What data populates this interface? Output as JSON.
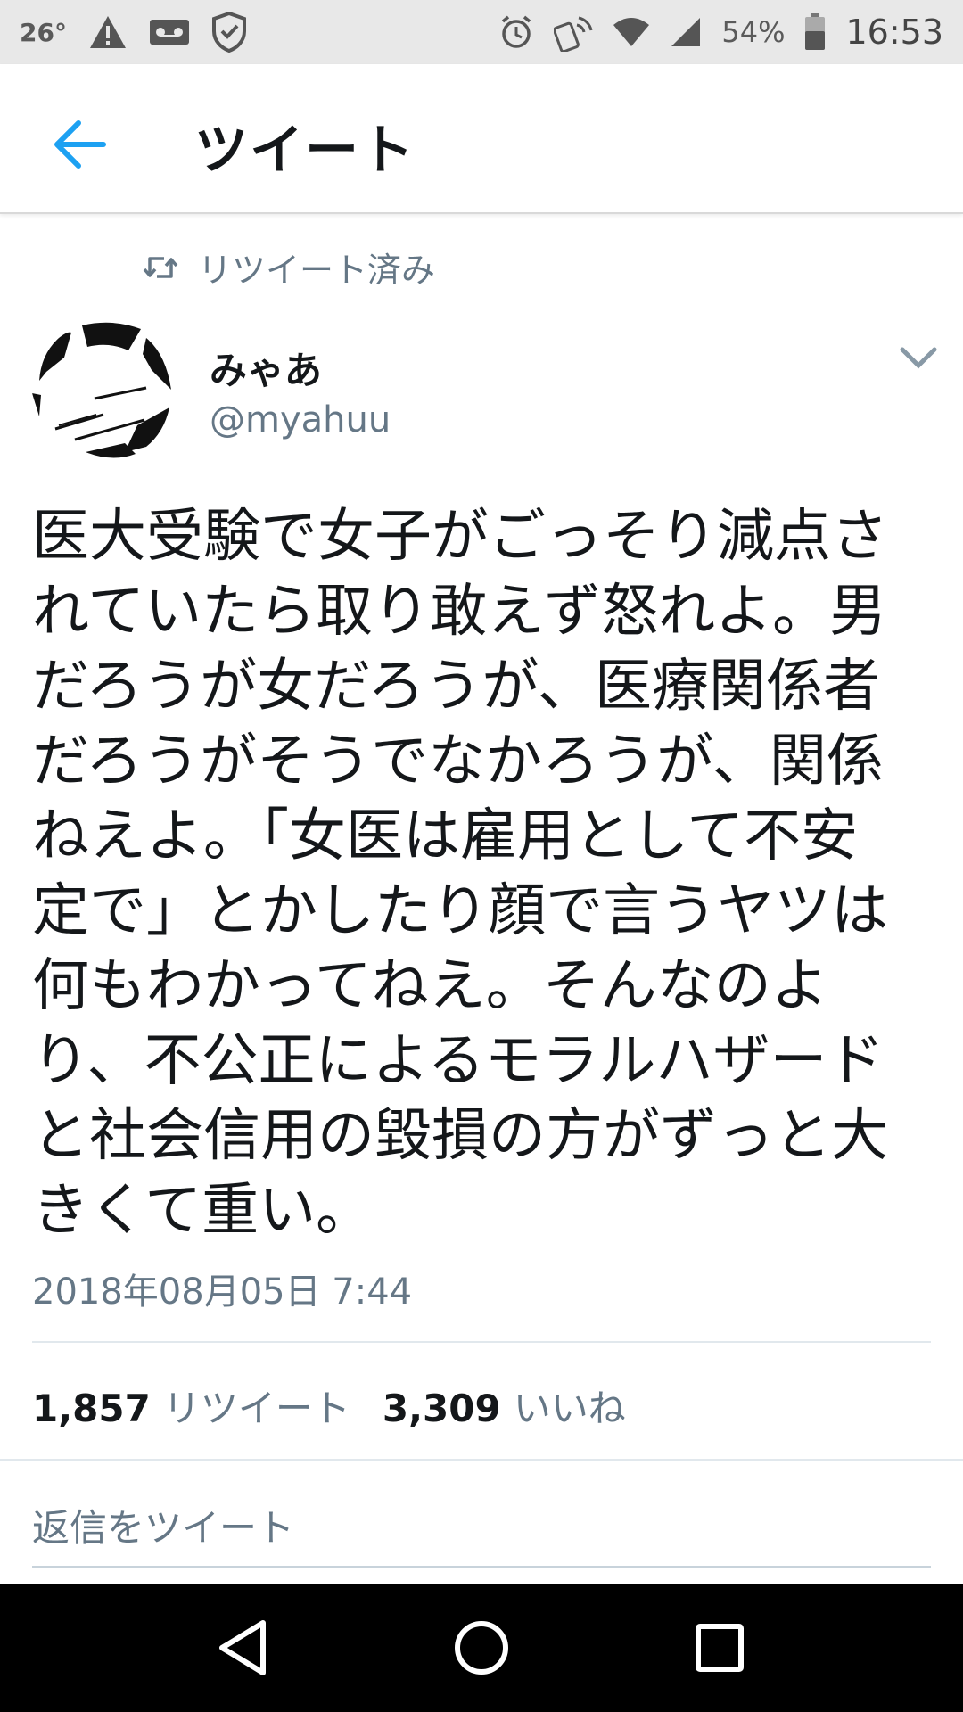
{
  "status_bar": {
    "temperature": "26°",
    "battery": "54%",
    "time": "16:53"
  },
  "header": {
    "title": "ツイート",
    "back_icon": "arrow-left-icon"
  },
  "tweet": {
    "retweeted_label": "リツイート済み",
    "display_name": "みゃあ",
    "handle": "@myahuu",
    "text_lines": [
      "医大受験で女子がごっそり減点さ",
      "れていたら取り敢えず怒れよ。男",
      "だろうが女だろうが、医療関係者",
      "だろうがそうでなかろうが、関係",
      "ねえよ。「女医は雇用として不安",
      "定で」とかしたり顔で言うヤツは",
      "何もわかってねえ。そんなのよ",
      "り、不公正によるモラルハザード",
      "と社会信用の毀損の方がずっと大",
      "きくて重い。"
    ],
    "timestamp": "2018年08月05日 7:44",
    "retweet_count": "1,857",
    "retweet_label": "リツイート",
    "like_count": "3,309",
    "like_label": "いいね"
  },
  "reply": {
    "placeholder": "返信をツイート"
  },
  "colors": {
    "accent": "#1da1f2",
    "secondary_text": "#657786",
    "primary_text": "#14171a"
  }
}
